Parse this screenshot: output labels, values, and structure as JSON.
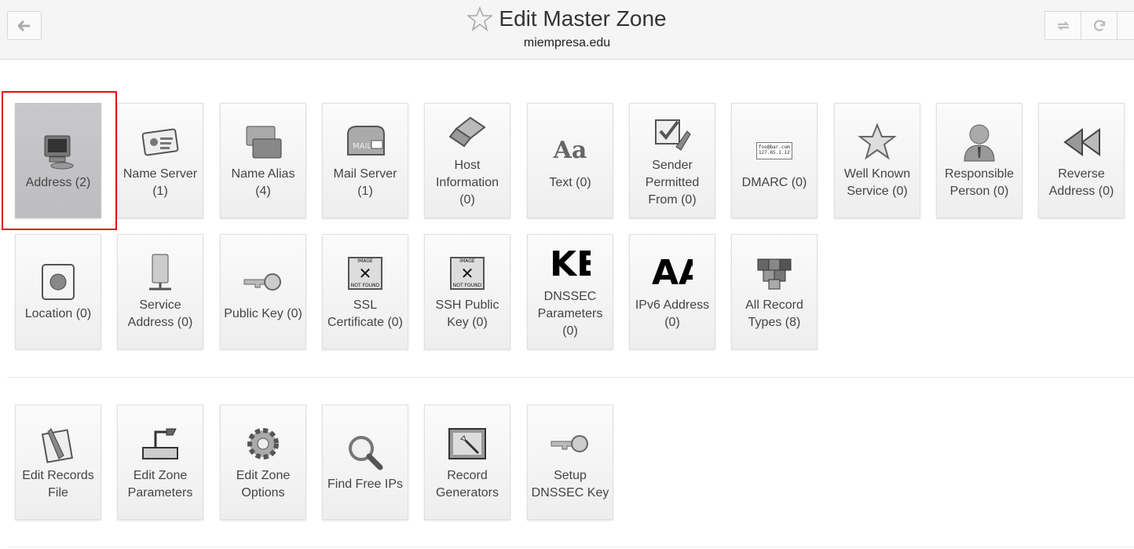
{
  "header": {
    "title": "Edit Master Zone",
    "subtitle": "miempresa.edu"
  },
  "record_types": [
    {
      "label": "Address (2)",
      "icon": "computer-icon",
      "selected": true
    },
    {
      "label": "Name Server (1)",
      "icon": "id-card-icon"
    },
    {
      "label": "Name Alias (4)",
      "icon": "windows-icon"
    },
    {
      "label": "Mail Server (1)",
      "icon": "mailbox-icon"
    },
    {
      "label": "Host Information (0)",
      "icon": "laptop-icon"
    },
    {
      "label": "Text (0)",
      "icon": "text-aa-icon",
      "glyph": "Aa"
    },
    {
      "label": "Sender Permitted From (0)",
      "icon": "checklist-wrench-icon"
    },
    {
      "label": "DMARC (0)",
      "icon": "address-card-icon",
      "card_lines": [
        "foo@bar.com",
        "127.65.1.12"
      ]
    },
    {
      "label": "Well Known Service (0)",
      "icon": "star-icon"
    },
    {
      "label": "Responsible Person (0)",
      "icon": "person-icon"
    },
    {
      "label": "Reverse Address (0)",
      "icon": "rewind-icon"
    },
    {
      "label": "Location (0)",
      "icon": "globe-icon"
    },
    {
      "label": "Service Address (0)",
      "icon": "server-icon"
    },
    {
      "label": "Public Key (0)",
      "icon": "key-icon"
    },
    {
      "label": "SSL Certificate (0)",
      "icon": "image-not-found-icon",
      "img_top": "IMAGE",
      "img_bottom": "NOT FOUND"
    },
    {
      "label": "SSH Public Key (0)",
      "icon": "image-not-found-icon",
      "img_top": "IMAGE",
      "img_bottom": "NOT FOUND"
    },
    {
      "label": "DNSSEC Parameters (0)",
      "icon": "broken-text-icon",
      "glyph": "KE"
    },
    {
      "label": "IPv6 Address (0)",
      "icon": "broken-text-icon",
      "glyph": "AA"
    },
    {
      "label": "All Record Types (8)",
      "icon": "cubes-icon"
    }
  ],
  "actions": [
    {
      "label": "Edit Records File",
      "icon": "document-pen-icon"
    },
    {
      "label": "Edit Zone Parameters",
      "icon": "projector-icon"
    },
    {
      "label": "Edit Zone Options",
      "icon": "gear-icon"
    },
    {
      "label": "Find Free IPs",
      "icon": "magnifier-icon"
    },
    {
      "label": "Record Generators",
      "icon": "magic-wand-icon"
    },
    {
      "label": "Setup DNSSEC Key",
      "icon": "key-icon"
    }
  ]
}
